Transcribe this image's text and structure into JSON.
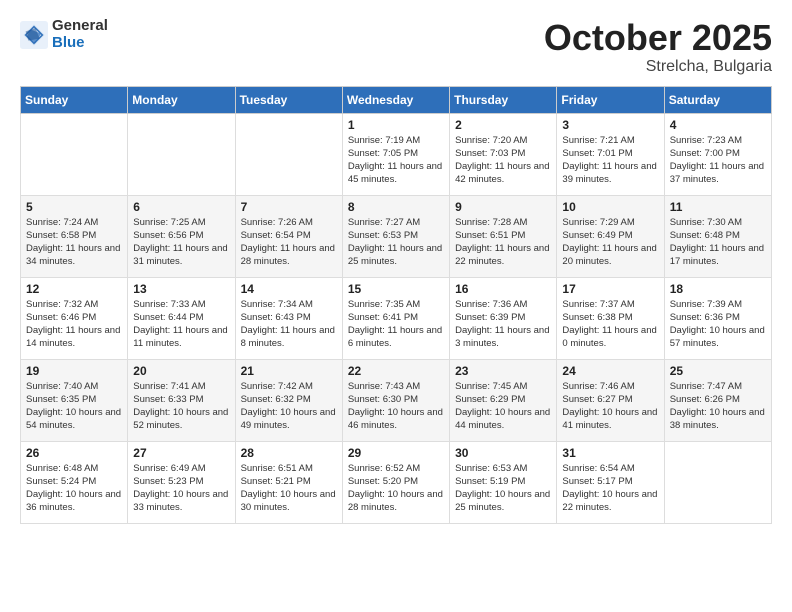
{
  "header": {
    "logo_general": "General",
    "logo_blue": "Blue",
    "month": "October 2025",
    "location": "Strelcha, Bulgaria"
  },
  "days_of_week": [
    "Sunday",
    "Monday",
    "Tuesday",
    "Wednesday",
    "Thursday",
    "Friday",
    "Saturday"
  ],
  "weeks": [
    [
      {
        "num": "",
        "info": ""
      },
      {
        "num": "",
        "info": ""
      },
      {
        "num": "",
        "info": ""
      },
      {
        "num": "1",
        "info": "Sunrise: 7:19 AM\nSunset: 7:05 PM\nDaylight: 11 hours and 45 minutes."
      },
      {
        "num": "2",
        "info": "Sunrise: 7:20 AM\nSunset: 7:03 PM\nDaylight: 11 hours and 42 minutes."
      },
      {
        "num": "3",
        "info": "Sunrise: 7:21 AM\nSunset: 7:01 PM\nDaylight: 11 hours and 39 minutes."
      },
      {
        "num": "4",
        "info": "Sunrise: 7:23 AM\nSunset: 7:00 PM\nDaylight: 11 hours and 37 minutes."
      }
    ],
    [
      {
        "num": "5",
        "info": "Sunrise: 7:24 AM\nSunset: 6:58 PM\nDaylight: 11 hours and 34 minutes."
      },
      {
        "num": "6",
        "info": "Sunrise: 7:25 AM\nSunset: 6:56 PM\nDaylight: 11 hours and 31 minutes."
      },
      {
        "num": "7",
        "info": "Sunrise: 7:26 AM\nSunset: 6:54 PM\nDaylight: 11 hours and 28 minutes."
      },
      {
        "num": "8",
        "info": "Sunrise: 7:27 AM\nSunset: 6:53 PM\nDaylight: 11 hours and 25 minutes."
      },
      {
        "num": "9",
        "info": "Sunrise: 7:28 AM\nSunset: 6:51 PM\nDaylight: 11 hours and 22 minutes."
      },
      {
        "num": "10",
        "info": "Sunrise: 7:29 AM\nSunset: 6:49 PM\nDaylight: 11 hours and 20 minutes."
      },
      {
        "num": "11",
        "info": "Sunrise: 7:30 AM\nSunset: 6:48 PM\nDaylight: 11 hours and 17 minutes."
      }
    ],
    [
      {
        "num": "12",
        "info": "Sunrise: 7:32 AM\nSunset: 6:46 PM\nDaylight: 11 hours and 14 minutes."
      },
      {
        "num": "13",
        "info": "Sunrise: 7:33 AM\nSunset: 6:44 PM\nDaylight: 11 hours and 11 minutes."
      },
      {
        "num": "14",
        "info": "Sunrise: 7:34 AM\nSunset: 6:43 PM\nDaylight: 11 hours and 8 minutes."
      },
      {
        "num": "15",
        "info": "Sunrise: 7:35 AM\nSunset: 6:41 PM\nDaylight: 11 hours and 6 minutes."
      },
      {
        "num": "16",
        "info": "Sunrise: 7:36 AM\nSunset: 6:39 PM\nDaylight: 11 hours and 3 minutes."
      },
      {
        "num": "17",
        "info": "Sunrise: 7:37 AM\nSunset: 6:38 PM\nDaylight: 11 hours and 0 minutes."
      },
      {
        "num": "18",
        "info": "Sunrise: 7:39 AM\nSunset: 6:36 PM\nDaylight: 10 hours and 57 minutes."
      }
    ],
    [
      {
        "num": "19",
        "info": "Sunrise: 7:40 AM\nSunset: 6:35 PM\nDaylight: 10 hours and 54 minutes."
      },
      {
        "num": "20",
        "info": "Sunrise: 7:41 AM\nSunset: 6:33 PM\nDaylight: 10 hours and 52 minutes."
      },
      {
        "num": "21",
        "info": "Sunrise: 7:42 AM\nSunset: 6:32 PM\nDaylight: 10 hours and 49 minutes."
      },
      {
        "num": "22",
        "info": "Sunrise: 7:43 AM\nSunset: 6:30 PM\nDaylight: 10 hours and 46 minutes."
      },
      {
        "num": "23",
        "info": "Sunrise: 7:45 AM\nSunset: 6:29 PM\nDaylight: 10 hours and 44 minutes."
      },
      {
        "num": "24",
        "info": "Sunrise: 7:46 AM\nSunset: 6:27 PM\nDaylight: 10 hours and 41 minutes."
      },
      {
        "num": "25",
        "info": "Sunrise: 7:47 AM\nSunset: 6:26 PM\nDaylight: 10 hours and 38 minutes."
      }
    ],
    [
      {
        "num": "26",
        "info": "Sunrise: 6:48 AM\nSunset: 5:24 PM\nDaylight: 10 hours and 36 minutes."
      },
      {
        "num": "27",
        "info": "Sunrise: 6:49 AM\nSunset: 5:23 PM\nDaylight: 10 hours and 33 minutes."
      },
      {
        "num": "28",
        "info": "Sunrise: 6:51 AM\nSunset: 5:21 PM\nDaylight: 10 hours and 30 minutes."
      },
      {
        "num": "29",
        "info": "Sunrise: 6:52 AM\nSunset: 5:20 PM\nDaylight: 10 hours and 28 minutes."
      },
      {
        "num": "30",
        "info": "Sunrise: 6:53 AM\nSunset: 5:19 PM\nDaylight: 10 hours and 25 minutes."
      },
      {
        "num": "31",
        "info": "Sunrise: 6:54 AM\nSunset: 5:17 PM\nDaylight: 10 hours and 22 minutes."
      },
      {
        "num": "",
        "info": ""
      }
    ]
  ]
}
